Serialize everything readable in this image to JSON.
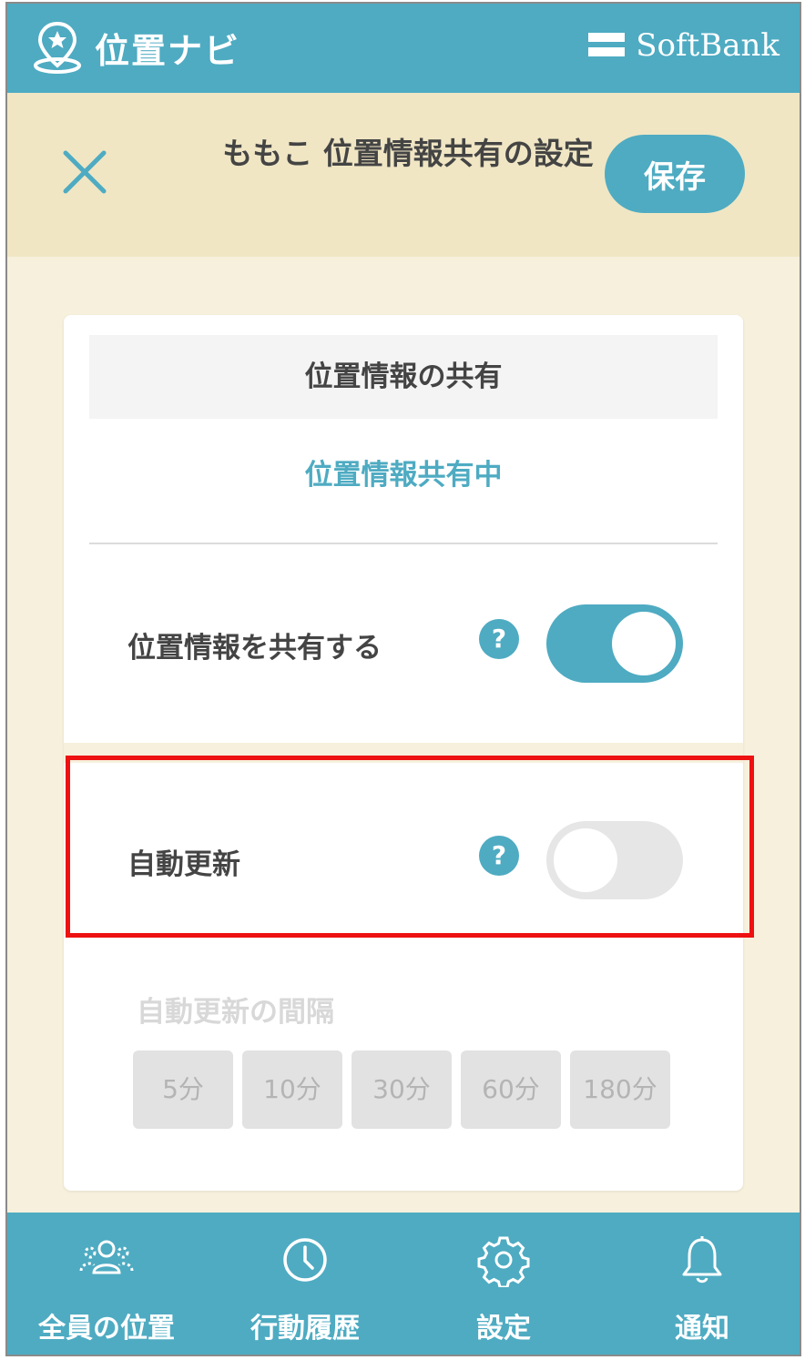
{
  "header": {
    "app_title": "位置ナビ",
    "brand": "SoftBank"
  },
  "subheader": {
    "title": "ももこ 位置情報共有の設定",
    "save_label": "保存"
  },
  "sharing": {
    "section_title": "位置情報の共有",
    "status": "位置情報共有中",
    "share_label": "位置情報を共有する",
    "share_enabled": true,
    "help_glyph": "?"
  },
  "auto_update": {
    "label": "自動更新",
    "enabled": false,
    "interval_title": "自動更新の間隔",
    "intervals": [
      "5分",
      "10分",
      "30分",
      "60分",
      "180分"
    ]
  },
  "nav": {
    "items": [
      {
        "label": "全員の位置",
        "icon": "people-icon"
      },
      {
        "label": "行動履歴",
        "icon": "clock-icon"
      },
      {
        "label": "設定",
        "icon": "gear-icon"
      },
      {
        "label": "通知",
        "icon": "bell-icon"
      }
    ]
  },
  "colors": {
    "accent": "#4eabc2",
    "background": "#f6f0dc",
    "subheader": "#f0e6c4",
    "highlight": "#ee1111"
  }
}
